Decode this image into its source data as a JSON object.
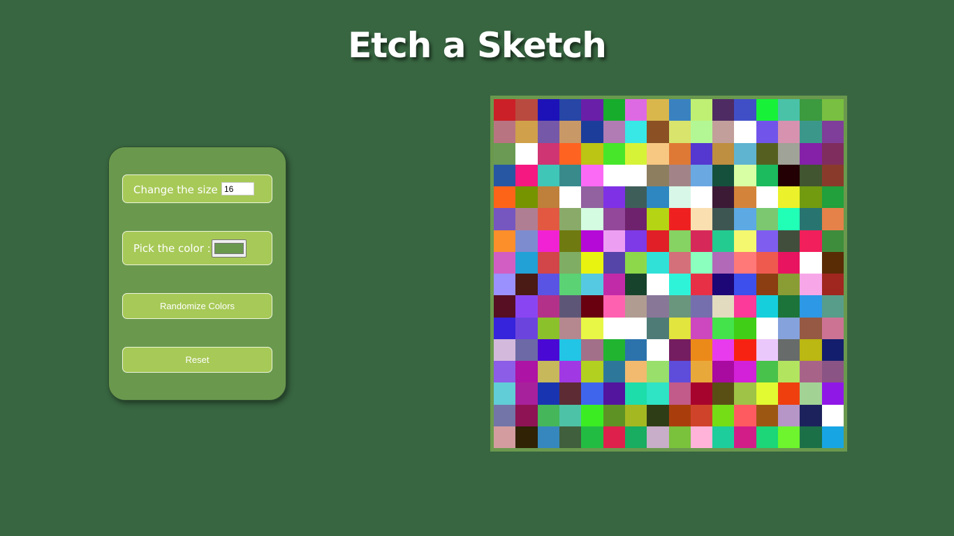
{
  "header": {
    "title": "Etch a Sketch"
  },
  "controls": {
    "size_label": "Change the size :",
    "size_value": "16",
    "color_label": "Pick the color :",
    "color_value": "#6a994e",
    "randomize_label": "Randomize Colors",
    "reset_label": "Reset"
  },
  "grid": {
    "size": 16,
    "cells": [
      [
        "#cb2027",
        "#b94a3f",
        "#1d12b8",
        "#2746a5",
        "#6a1fa8",
        "#18ac2d",
        "#de6ae3",
        "#d9b74c",
        "#3982bf",
        "#c0f073",
        "#4e2b63",
        "#414fc7",
        "#17f238",
        "#4ac2a8",
        "#3c9a3f",
        "#79bf41"
      ],
      [
        "#b97482",
        "#d0a14a",
        "#7558a8",
        "#c89967",
        "#1d3d9a",
        "#b07cb3",
        "#37e8e6",
        "#8b5024",
        "#d9e46c",
        "#b3f795",
        "#c29f9b",
        "#ffffff",
        "#7155ea",
        "#d692af",
        "#3c978b",
        "#7f3e99"
      ],
      [
        "#6a9a53",
        "#ffffff",
        "#cf3572",
        "#ff6322",
        "#bcc414",
        "#47e62b",
        "#d7f338",
        "#f7c882",
        "#de7935",
        "#5438d0",
        "#be8f40",
        "#5fb4d0",
        "#556020",
        "#a0a397",
        "#8421a8",
        "#7f2d5e"
      ],
      [
        "#2757a3",
        "#f41880",
        "#3fc6b6",
        "#388a8b",
        "#fb6af5",
        "#ffffff",
        "#ffffff",
        "#8d7e5f",
        "#a28488",
        "#6aa8e2",
        "#15503d",
        "#d9ffa4",
        "#1cbb5d",
        "#220004",
        "#405530",
        "#8a3a2b"
      ],
      [
        "#fe6418",
        "#759400",
        "#be803a",
        "#ffffff",
        "#9261a0",
        "#7f31e5",
        "#3e5e5a",
        "#2e87c0",
        "#d8f7e8",
        "#ffffff",
        "#3c1a36",
        "#d4843a",
        "#ffffff",
        "#ebf12a",
        "#729b10",
        "#21a03c"
      ],
      [
        "#7657c0",
        "#b07e93",
        "#e35841",
        "#8aaa6a",
        "#d4fce1",
        "#93489a",
        "#6e226d",
        "#b5d413",
        "#ef2120",
        "#fadfb0",
        "#3d5651",
        "#5ca9e3",
        "#7bc870",
        "#21ffb6",
        "#287470",
        "#e58249"
      ],
      [
        "#fd8f2a",
        "#7d8ccf",
        "#f122d3",
        "#6f7a11",
        "#b509d7",
        "#ec9ff2",
        "#7e3ae6",
        "#e11f26",
        "#86d263",
        "#d6295a",
        "#24cb90",
        "#f4f86e",
        "#7e5def",
        "#424e3c",
        "#f11f5b",
        "#3e8d3d"
      ],
      [
        "#d25ec4",
        "#21a1d6",
        "#d24649",
        "#7fad64",
        "#e9f310",
        "#5545a8",
        "#8cd84a",
        "#30e1d7",
        "#d47079",
        "#8affbe",
        "#b269b8",
        "#ff7978",
        "#ef5a4f",
        "#e81460",
        "#ffffff",
        "#5a2c06"
      ],
      [
        "#9a91fe",
        "#4a1b15",
        "#5a54e5",
        "#5bd274",
        "#56c9e2",
        "#c22ba8",
        "#17432c",
        "#ffffff",
        "#2ff3d9",
        "#e73046",
        "#1d0676",
        "#3d4fec",
        "#8b3e12",
        "#899d34",
        "#f7a7e8",
        "#a02620"
      ],
      [
        "#560f23",
        "#8a45f3",
        "#b33189",
        "#5e5677",
        "#690010",
        "#ff61b1",
        "#b09c91",
        "#897798",
        "#6a967e",
        "#7570ad",
        "#e2dbbf",
        "#fb3a99",
        "#15d0dc",
        "#1c743a",
        "#2d98e5",
        "#579d8a"
      ],
      [
        "#3524db",
        "#6b44de",
        "#8bc12a",
        "#b58890",
        "#e8f745",
        "#ffffff",
        "#ffffff",
        "#4f7b77",
        "#e1e53d",
        "#cd48bf",
        "#44e34b",
        "#40ce16",
        "#ffffff",
        "#86a2dc",
        "#955944",
        "#cc7394"
      ],
      [
        "#d3b9dc",
        "#6d69a6",
        "#4a08d4",
        "#22c5e6",
        "#a27088",
        "#21b431",
        "#2c73ac",
        "#ffffff",
        "#741d60",
        "#ec8a19",
        "#e83bed",
        "#f82213",
        "#ebc8fb",
        "#676b6a",
        "#bbb713",
        "#131e6d"
      ],
      [
        "#8c5de6",
        "#ad13a4",
        "#c6b85b",
        "#a038e4",
        "#b1d020",
        "#2d779b",
        "#f1ba6e",
        "#98df6b",
        "#5e4dda",
        "#e9a93a",
        "#a90aa0",
        "#d321d9",
        "#49c24b",
        "#b3e460",
        "#a86488",
        "#8a5485"
      ],
      [
        "#61cdd6",
        "#a8219c",
        "#1934b0",
        "#5d2b34",
        "#3f65ed",
        "#53149e",
        "#1dddab",
        "#2fe3c5",
        "#c25a8a",
        "#a7042d",
        "#594f15",
        "#9fc346",
        "#e1fa31",
        "#ef3f0f",
        "#a2d395",
        "#8f18e7"
      ],
      [
        "#7375a8",
        "#8e1354",
        "#45b659",
        "#4ec2a6",
        "#3bec23",
        "#5e9224",
        "#a4b821",
        "#2f3d17",
        "#a93e0c",
        "#d0432b",
        "#74dd15",
        "#fe5b60",
        "#9c5812",
        "#b596c7",
        "#1c225c",
        "#ffffff"
      ],
      [
        "#d39da0",
        "#2f2205",
        "#3587be",
        "#405f3d",
        "#23bc42",
        "#de204c",
        "#18ad60",
        "#c8aec8",
        "#7ac13c",
        "#ffb3d9",
        "#1dcd9b",
        "#d21d89",
        "#1cd677",
        "#6ef52d",
        "#1c7047",
        "#17a5e3"
      ]
    ]
  }
}
